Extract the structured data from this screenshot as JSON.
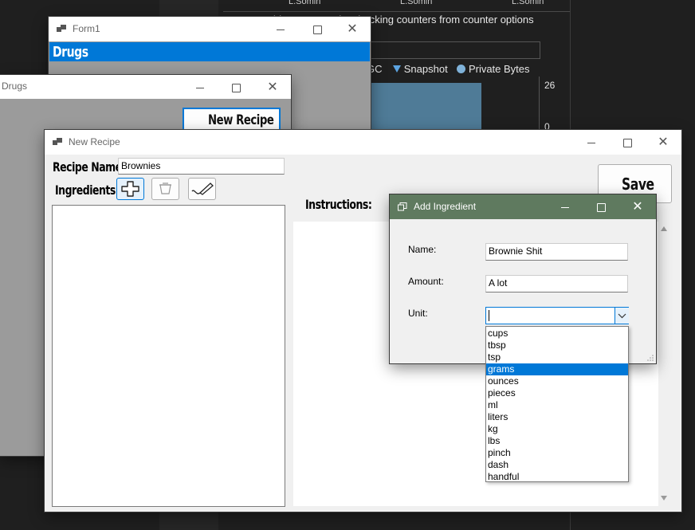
{
  "background_app": {
    "top_labels": [
      "L.Somin",
      "L.Somin",
      "L.Somin"
    ],
    "hint_text": "Add counters or by checking counters from counter options",
    "legend": [
      {
        "label": "GC",
        "color": "#9aa8b6"
      },
      {
        "label": "Snapshot",
        "color": "#5ba3e0"
      },
      {
        "label": "Private Bytes",
        "color": "#7fb2d9"
      }
    ],
    "axis_max": "26",
    "axis_min": "0"
  },
  "form1": {
    "title": "Form1",
    "header": "Drugs"
  },
  "drugs_window": {
    "title": "Drugs",
    "new_recipe_button": "New Recipe"
  },
  "new_recipe": {
    "title": "New Recipe",
    "recipe_name_label": "Recipe Name:",
    "recipe_name_value": "Brownies",
    "ingredients_label": "Ingredients:",
    "instructions_label": "Instructions:",
    "save_button": "Save"
  },
  "add_ingredient": {
    "title": "Add Ingredient",
    "name_label": "Name:",
    "name_value": "Brownie Shit",
    "amount_label": "Amount:",
    "amount_value": "A lot",
    "unit_label": "Unit:",
    "unit_value": "",
    "unit_options": [
      "cups",
      "tbsp",
      "tsp",
      "grams",
      "ounces",
      "pieces",
      "ml",
      "liters",
      "kg",
      "lbs",
      "pinch",
      "dash",
      "handful"
    ],
    "highlighted_option": "grams"
  },
  "colors": {
    "accent": "#0078d7",
    "dialog_titlebar": "#5f7a5f"
  }
}
